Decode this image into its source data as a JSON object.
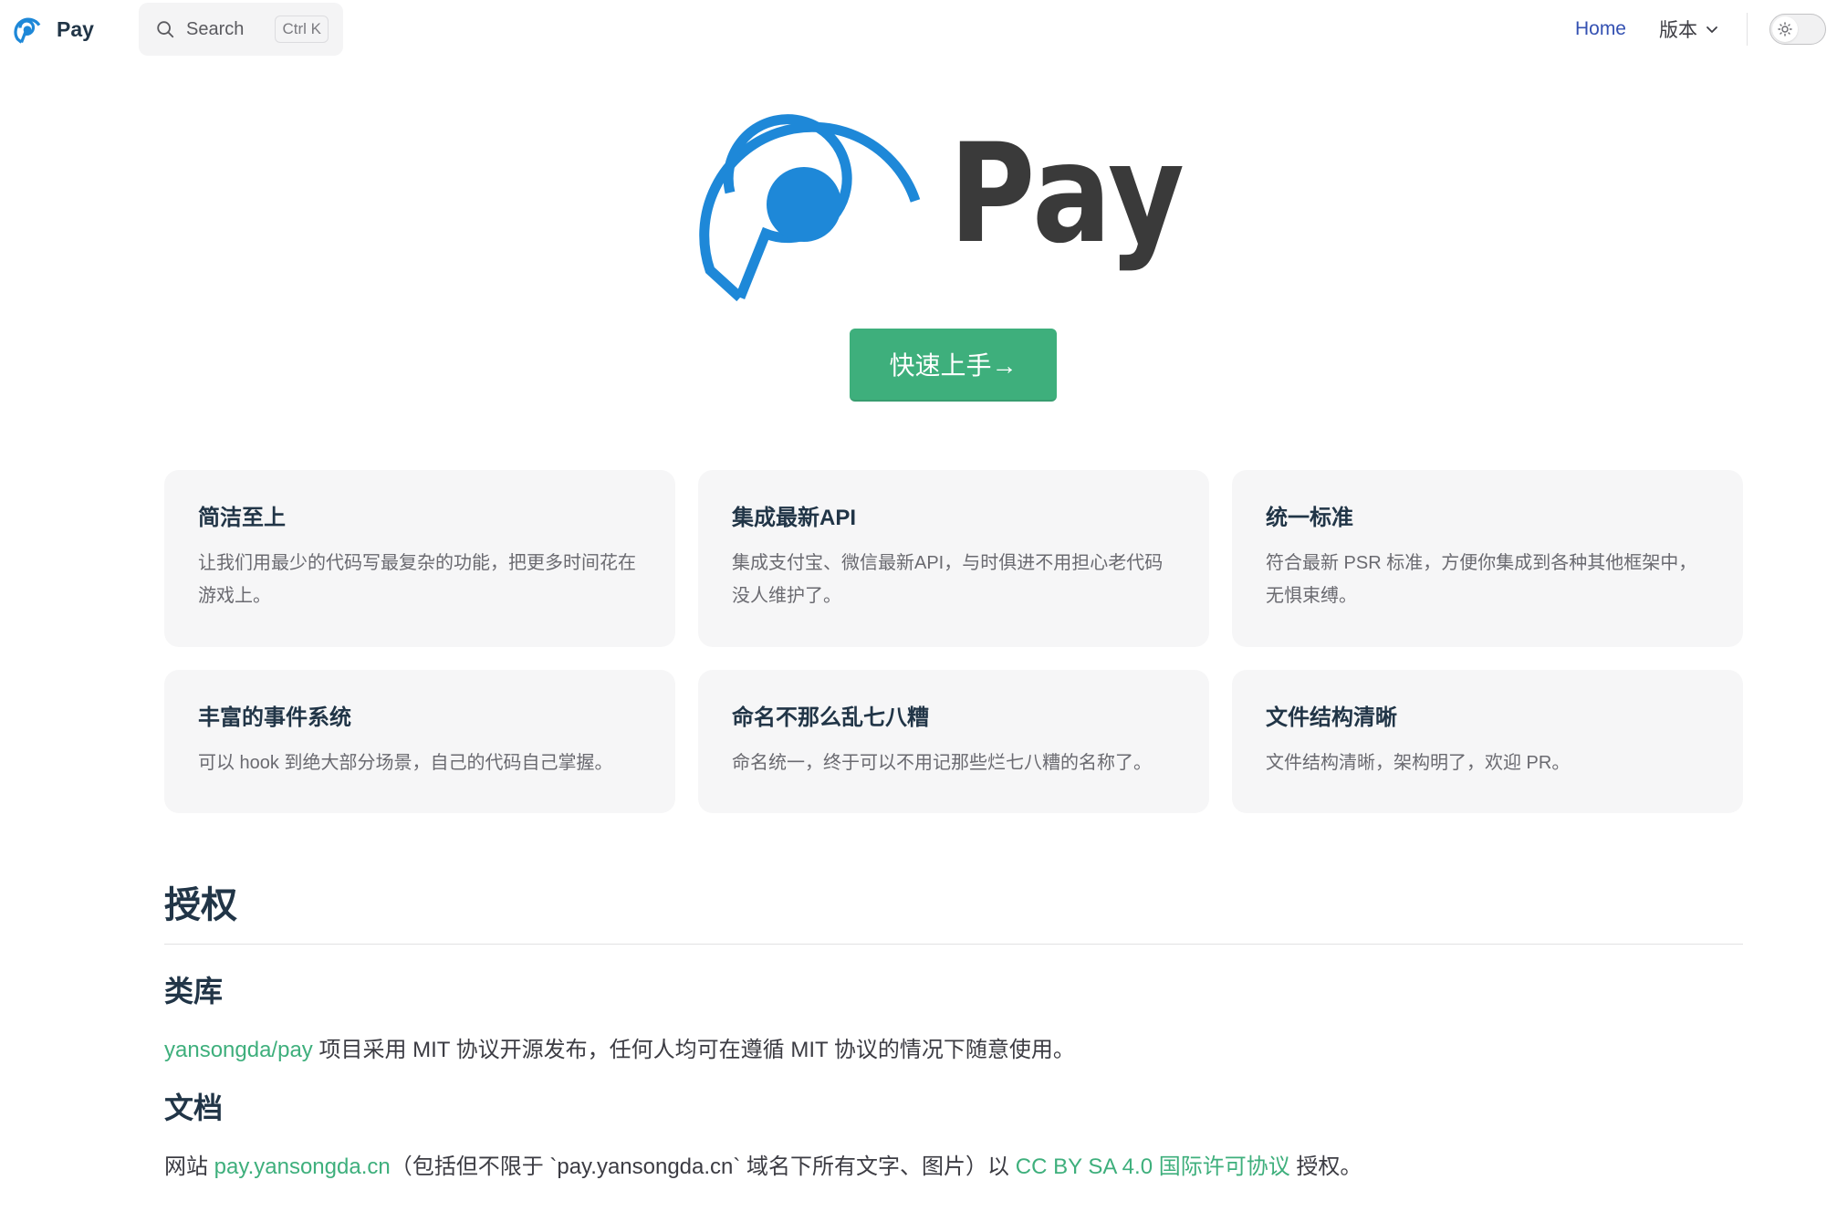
{
  "nav": {
    "site_title": "Pay",
    "search": {
      "label": "Search",
      "kbd_ctrl": "Ctrl",
      "kbd_key": "K"
    },
    "links": {
      "home": "Home",
      "versions": "版本"
    },
    "theme_toggle": {
      "mode": "light",
      "icon": "sun-icon"
    }
  },
  "hero": {
    "logo_text": "Pay",
    "cta_label": "快速上手→",
    "colors": {
      "logo_blue": "#1E88D8",
      "wordmark": "#3A3A3A",
      "cta": "#3EAF7C"
    }
  },
  "features": [
    {
      "title": "简洁至上",
      "desc": "让我们用最少的代码写最复杂的功能，把更多时间花在游戏上。"
    },
    {
      "title": "集成最新API",
      "desc": "集成支付宝、微信最新API，与时俱进不用担心老代码没人维护了。"
    },
    {
      "title": "统一标准",
      "desc": "符合最新 PSR 标准，方便你集成到各种其他框架中，无惧束缚。"
    },
    {
      "title": "丰富的事件系统",
      "desc": "可以 hook 到绝大部分场景，自己的代码自己掌握。"
    },
    {
      "title": "命名不那么乱七八糟",
      "desc": "命名统一，终于可以不用记那些烂七八糟的名称了。"
    },
    {
      "title": "文件结构清晰",
      "desc": "文件结构清晰，架构明了，欢迎 PR。"
    }
  ],
  "license": {
    "heading": "授权",
    "library": {
      "heading": "类库",
      "link_text": "yansongda/pay",
      "text": " 项目采用 MIT 协议开源发布，任何人均可在遵循 MIT 协议的情况下随意使用。"
    },
    "docs": {
      "heading": "文档",
      "prefix": "网站 ",
      "site_link": "pay.yansongda.cn",
      "middle": "（包括但不限于 `pay.yansongda.cn` 域名下所有文字、图片）以 ",
      "license_link": "CC BY SA 4.0 国际许可协议",
      "suffix": " 授权。"
    }
  }
}
